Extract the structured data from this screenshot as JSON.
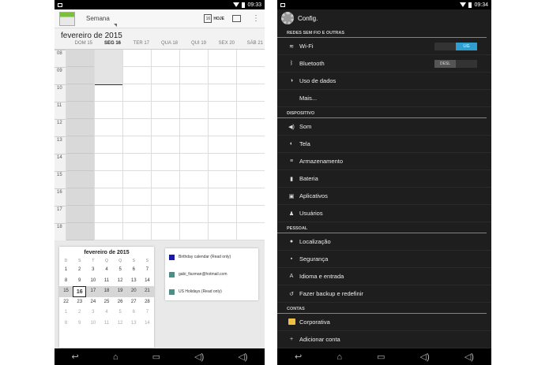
{
  "left": {
    "status": {
      "time": "09:33"
    },
    "toolbar": {
      "view": "Semana",
      "today_label": "HOJE",
      "today_num": "16"
    },
    "month_title": "fevereiro de 2015",
    "day_headers": [
      "DOM 15",
      "SEG 16",
      "TER 17",
      "QUA 18",
      "QUI 19",
      "SEX 20",
      "SÁB 21"
    ],
    "hours": [
      "08",
      "09",
      "10",
      "11",
      "12",
      "13",
      "14",
      "15",
      "16",
      "17",
      "18"
    ],
    "minical": {
      "title": "fevereiro de 2015",
      "weekdays": [
        "D",
        "S",
        "T",
        "Q",
        "Q",
        "S",
        "S"
      ],
      "weeks": [
        [
          "1",
          "2",
          "3",
          "4",
          "5",
          "6",
          "7"
        ],
        [
          "8",
          "9",
          "10",
          "11",
          "12",
          "13",
          "14"
        ],
        [
          "15",
          "16",
          "17",
          "18",
          "19",
          "20",
          "21"
        ],
        [
          "22",
          "23",
          "24",
          "25",
          "26",
          "27",
          "28"
        ],
        [
          "1",
          "2",
          "3",
          "4",
          "5",
          "6",
          "7"
        ],
        [
          "8",
          "9",
          "10",
          "11",
          "12",
          "13",
          "14"
        ]
      ]
    },
    "calendars": [
      {
        "name": "Birthday calendar (Read only)",
        "color": "#1a1aa8"
      },
      {
        "name": "gabi_fiszman@hotmail.com",
        "color": "#4a8f84"
      },
      {
        "name": "US Holidays (Read only)",
        "color": "#4a8f84"
      }
    ],
    "nav": [
      "↩",
      "⌂",
      "▭",
      "◁)",
      "◁)"
    ]
  },
  "right": {
    "status": {
      "time": "09:34"
    },
    "title": "Config.",
    "sections": [
      {
        "header": "REDES SEM FIO E OUTRAS",
        "items": [
          {
            "label": "Wi-Fi",
            "icon": "wifi-icon",
            "glyph": "≋",
            "toggle": "LIG"
          },
          {
            "label": "Bluetooth",
            "icon": "bluetooth-icon",
            "glyph": "ᛒ",
            "toggle": "DESL"
          },
          {
            "label": "Uso de dados",
            "icon": "data-usage-icon",
            "glyph": "◑"
          },
          {
            "label": "Mais...",
            "icon": "",
            "glyph": ""
          }
        ]
      },
      {
        "header": "DISPOSITIVO",
        "items": [
          {
            "label": "Som",
            "icon": "sound-icon",
            "glyph": "◀)"
          },
          {
            "label": "Tela",
            "icon": "display-icon",
            "glyph": "◐"
          },
          {
            "label": "Armazenamento",
            "icon": "storage-icon",
            "glyph": "≡"
          },
          {
            "label": "Bateria",
            "icon": "battery-icon",
            "glyph": "▮"
          },
          {
            "label": "Aplicativos",
            "icon": "apps-icon",
            "glyph": "▣"
          },
          {
            "label": "Usuários",
            "icon": "users-icon",
            "glyph": "♟"
          }
        ]
      },
      {
        "header": "PESSOAL",
        "items": [
          {
            "label": "Localização",
            "icon": "location-icon",
            "glyph": "●"
          },
          {
            "label": "Segurança",
            "icon": "lock-icon",
            "glyph": "▪"
          },
          {
            "label": "Idioma e entrada",
            "icon": "language-icon",
            "glyph": "A"
          },
          {
            "label": "Fazer backup e redefinir",
            "icon": "backup-icon",
            "glyph": "↺"
          }
        ]
      },
      {
        "header": "CONTAS",
        "items": [
          {
            "label": "Corporativa",
            "icon": "corporate-icon",
            "glyph": ""
          },
          {
            "label": "Adicionar conta",
            "icon": "add-icon",
            "glyph": "+"
          }
        ]
      }
    ],
    "nav": [
      "↩",
      "⌂",
      "▭",
      "◁)",
      "◁)"
    ]
  }
}
